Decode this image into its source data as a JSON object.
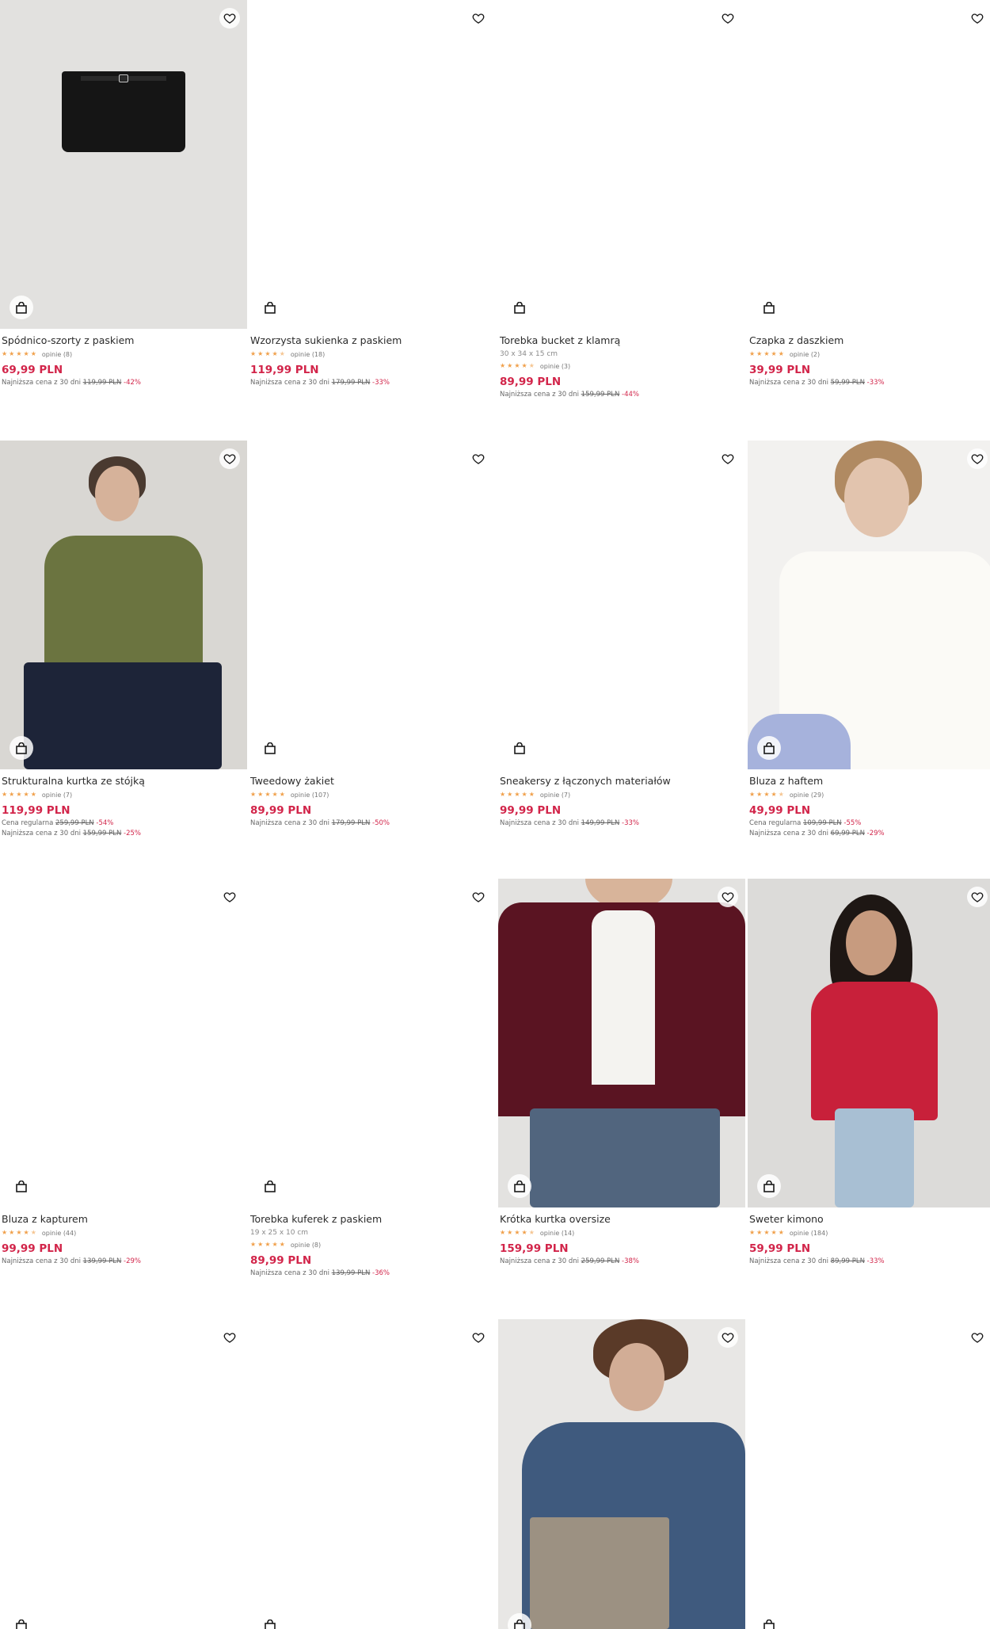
{
  "products": [
    {
      "name": "Spódnico-szorty z paskiem",
      "dims": "",
      "stars": [
        1,
        1,
        1,
        1,
        1
      ],
      "reviews": "opinie (8)",
      "price": "69,99 PLN",
      "notes": [
        {
          "label": "Najniższa cena z 30 dni",
          "old": "119,99 PLN",
          "pct": "-42%"
        }
      ]
    },
    {
      "name": "Wzorzysta sukienka z paskiem",
      "dims": "",
      "stars": [
        1,
        1,
        1,
        1,
        0.5
      ],
      "reviews": "opinie (18)",
      "price": "119,99 PLN",
      "notes": [
        {
          "label": "Najniższa cena z 30 dni",
          "old": "179,99 PLN",
          "pct": "-33%"
        }
      ]
    },
    {
      "name": "Torebka bucket z klamrą",
      "dims": "30 x 34 x 15 cm",
      "stars": [
        1,
        1,
        1,
        1,
        0.5
      ],
      "reviews": "opinie (3)",
      "price": "89,99 PLN",
      "notes": [
        {
          "label": "Najniższa cena z 30 dni",
          "old": "159,99 PLN",
          "pct": "-44%"
        }
      ]
    },
    {
      "name": "Czapka z daszkiem",
      "dims": "",
      "stars": [
        1,
        1,
        1,
        1,
        1
      ],
      "reviews": "opinie (2)",
      "price": "39,99 PLN",
      "notes": [
        {
          "label": "Najniższa cena z 30 dni",
          "old": "59,99 PLN",
          "pct": "-33%"
        }
      ]
    },
    {
      "name": "Strukturalna kurtka ze stójką",
      "dims": "",
      "stars": [
        1,
        1,
        1,
        1,
        1
      ],
      "reviews": "opinie (7)",
      "price": "119,99 PLN",
      "notes": [
        {
          "label": "Cena regularna",
          "old": "259,99 PLN",
          "pct": "-54%"
        },
        {
          "label": "Najniższa cena z 30 dni",
          "old": "159,99 PLN",
          "pct": "-25%"
        }
      ]
    },
    {
      "name": "Tweedowy żakiet",
      "dims": "",
      "stars": [
        1,
        1,
        1,
        1,
        1
      ],
      "reviews": "opinie (107)",
      "price": "89,99 PLN",
      "notes": [
        {
          "label": "Najniższa cena z 30 dni",
          "old": "179,99 PLN",
          "pct": "-50%"
        }
      ]
    },
    {
      "name": "Sneakersy z łączonych materiałów",
      "dims": "",
      "stars": [
        1,
        1,
        1,
        1,
        1
      ],
      "reviews": "opinie (7)",
      "price": "99,99 PLN",
      "notes": [
        {
          "label": "Najniższa cena z 30 dni",
          "old": "149,99 PLN",
          "pct": "-33%"
        }
      ]
    },
    {
      "name": "Bluza z haftem",
      "dims": "",
      "stars": [
        1,
        1,
        1,
        1,
        0.5
      ],
      "reviews": "opinie (29)",
      "price": "49,99 PLN",
      "notes": [
        {
          "label": "Cena regularna",
          "old": "109,99 PLN",
          "pct": "-55%"
        },
        {
          "label": "Najniższa cena z 30 dni",
          "old": "69,99 PLN",
          "pct": "-29%"
        }
      ]
    },
    {
      "name": "Bluza z kapturem",
      "dims": "",
      "stars": [
        1,
        1,
        1,
        1,
        0.5
      ],
      "reviews": "opinie (44)",
      "price": "99,99 PLN",
      "notes": [
        {
          "label": "Najniższa cena z 30 dni",
          "old": "139,99 PLN",
          "pct": "-29%"
        }
      ]
    },
    {
      "name": "Torebka kuferek z paskiem",
      "dims": "19 x 25 x 10 cm",
      "stars": [
        1,
        1,
        1,
        1,
        1
      ],
      "reviews": "opinie (8)",
      "price": "89,99 PLN",
      "notes": [
        {
          "label": "Najniższa cena z 30 dni",
          "old": "139,99 PLN",
          "pct": "-36%"
        }
      ]
    },
    {
      "name": "Krótka kurtka oversize",
      "dims": "",
      "stars": [
        1,
        1,
        1,
        1,
        0.5
      ],
      "reviews": "opinie (14)",
      "price": "159,99 PLN",
      "notes": [
        {
          "label": "Najniższa cena z 30 dni",
          "old": "259,99 PLN",
          "pct": "-38%"
        }
      ]
    },
    {
      "name": "Sweter kimono",
      "dims": "",
      "stars": [
        1,
        1,
        1,
        1,
        1
      ],
      "reviews": "opinie (184)",
      "price": "59,99 PLN",
      "notes": [
        {
          "label": "Najniższa cena z 30 dni",
          "old": "89,99 PLN",
          "pct": "-33%"
        }
      ]
    }
  ],
  "colors": {
    "price": "#d2254a",
    "star": "#f0a04b"
  },
  "icons": {
    "favorite": "heart-icon",
    "cart": "shopping-bag-icon"
  }
}
